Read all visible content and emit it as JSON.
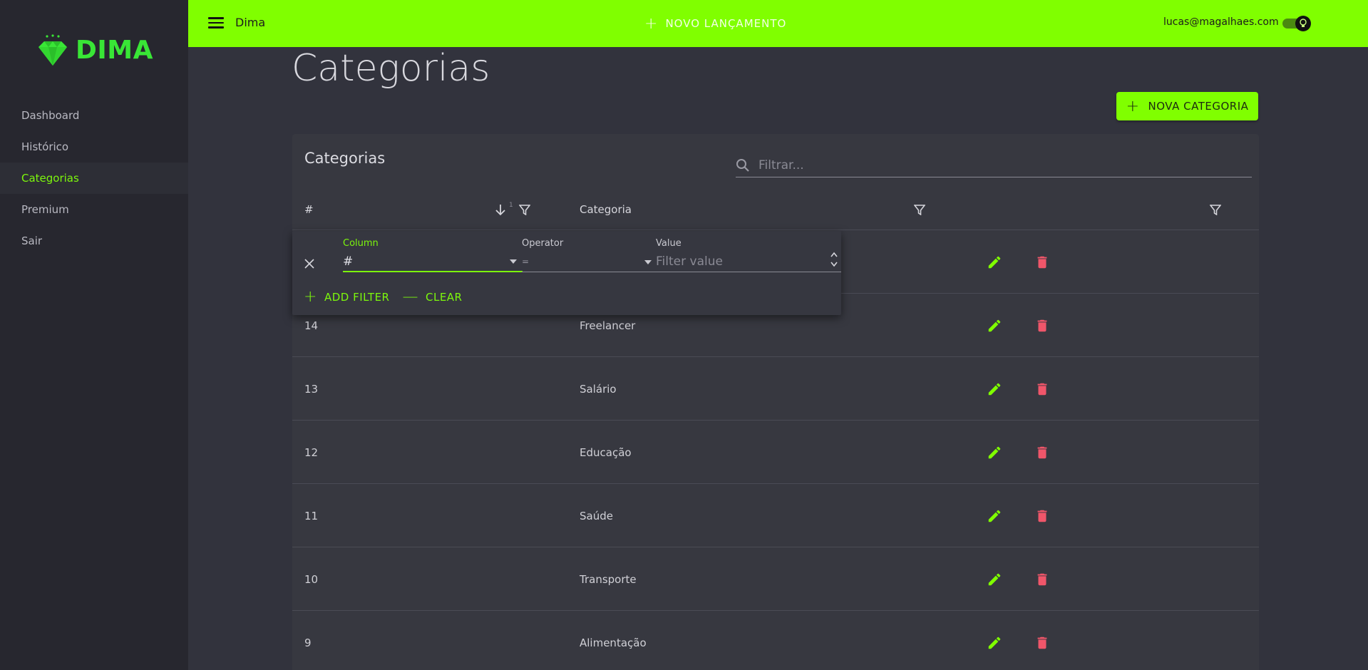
{
  "sidebar": {
    "logo_text": "DIMA",
    "items": [
      {
        "label": "Dashboard"
      },
      {
        "label": "Histórico"
      },
      {
        "label": "Categorias"
      },
      {
        "label": "Premium"
      },
      {
        "label": "Sair"
      }
    ],
    "active": "Categorias"
  },
  "topbar": {
    "app_title": "Dima",
    "new_entry_label": "NOVO LANÇAMENTO",
    "user_email": "lucas@magalhaes.com",
    "accent_color": "#80ff00"
  },
  "page": {
    "title": "Categorias",
    "new_category_label": "NOVA CATEGORIA"
  },
  "table": {
    "title": "Categorias",
    "search_placeholder": "Filtrar...",
    "columns": {
      "id": "#",
      "sort_index": "1",
      "name": "Categoria"
    },
    "rows": [
      {
        "id": "14",
        "name": "Freelancer"
      },
      {
        "id": "13",
        "name": "Salário"
      },
      {
        "id": "12",
        "name": "Educação"
      },
      {
        "id": "11",
        "name": "Saúde"
      },
      {
        "id": "10",
        "name": "Transporte"
      },
      {
        "id": "9",
        "name": "Alimentação"
      }
    ],
    "icons": {
      "edit": "pencil-icon",
      "delete": "trash-icon",
      "edit_color": "#80ff00",
      "delete_color": "#f0566a"
    }
  },
  "filter_panel": {
    "column_label": "Column",
    "column_value": "#",
    "operator_label": "Operator",
    "operator_value": "=",
    "value_label": "Value",
    "value_placeholder": "Filter value",
    "add_filter_label": "ADD FILTER",
    "clear_label": "CLEAR"
  }
}
